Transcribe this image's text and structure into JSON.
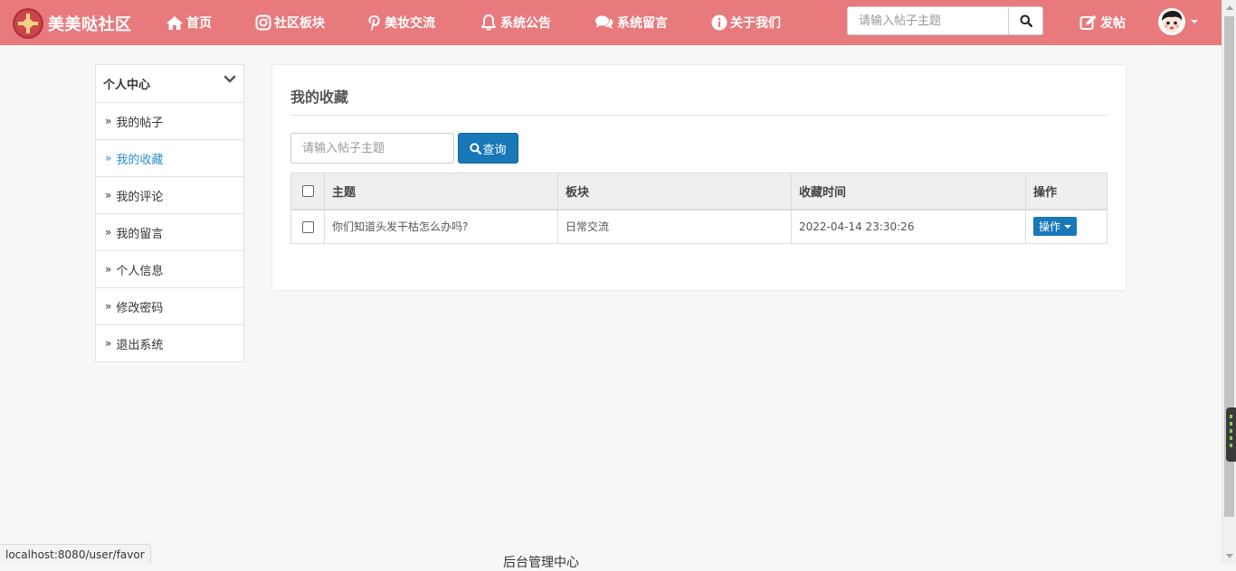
{
  "brand": {
    "name": "美美哒社区",
    "accent": "#e87a7d"
  },
  "nav": [
    {
      "label": "首页",
      "icon": "home-icon"
    },
    {
      "label": "社区板块",
      "icon": "instagram-icon"
    },
    {
      "label": "美妆交流",
      "icon": "pinterest-icon"
    },
    {
      "label": "系统公告",
      "icon": "bell-icon"
    },
    {
      "label": "系统留言",
      "icon": "comments-icon"
    },
    {
      "label": "关于我们",
      "icon": "info-icon"
    }
  ],
  "search": {
    "placeholder": "请输入帖子主题",
    "icon": "search-icon"
  },
  "post_button": {
    "label": "发帖",
    "icon": "edit-icon"
  },
  "sidebar": {
    "title": "个人中心",
    "items": [
      {
        "label": "我的帖子"
      },
      {
        "label": "我的收藏",
        "active": true
      },
      {
        "label": "我的评论"
      },
      {
        "label": "我的留言"
      },
      {
        "label": "个人信息"
      },
      {
        "label": "修改密码"
      },
      {
        "label": "退出系统"
      }
    ]
  },
  "main": {
    "title": "我的收藏",
    "filter_placeholder": "请输入帖子主题",
    "query_label": "查询",
    "columns": [
      "主题",
      "板块",
      "收藏时间",
      "操作"
    ],
    "rows": [
      {
        "topic": "你们知道头发干枯怎么办吗?",
        "board": "日常交流",
        "time": "2022-04-14 23:30:26",
        "action": "操作"
      }
    ]
  },
  "footer": {
    "text": "后台管理中心"
  },
  "status_url": "localhost:8080/user/favor"
}
